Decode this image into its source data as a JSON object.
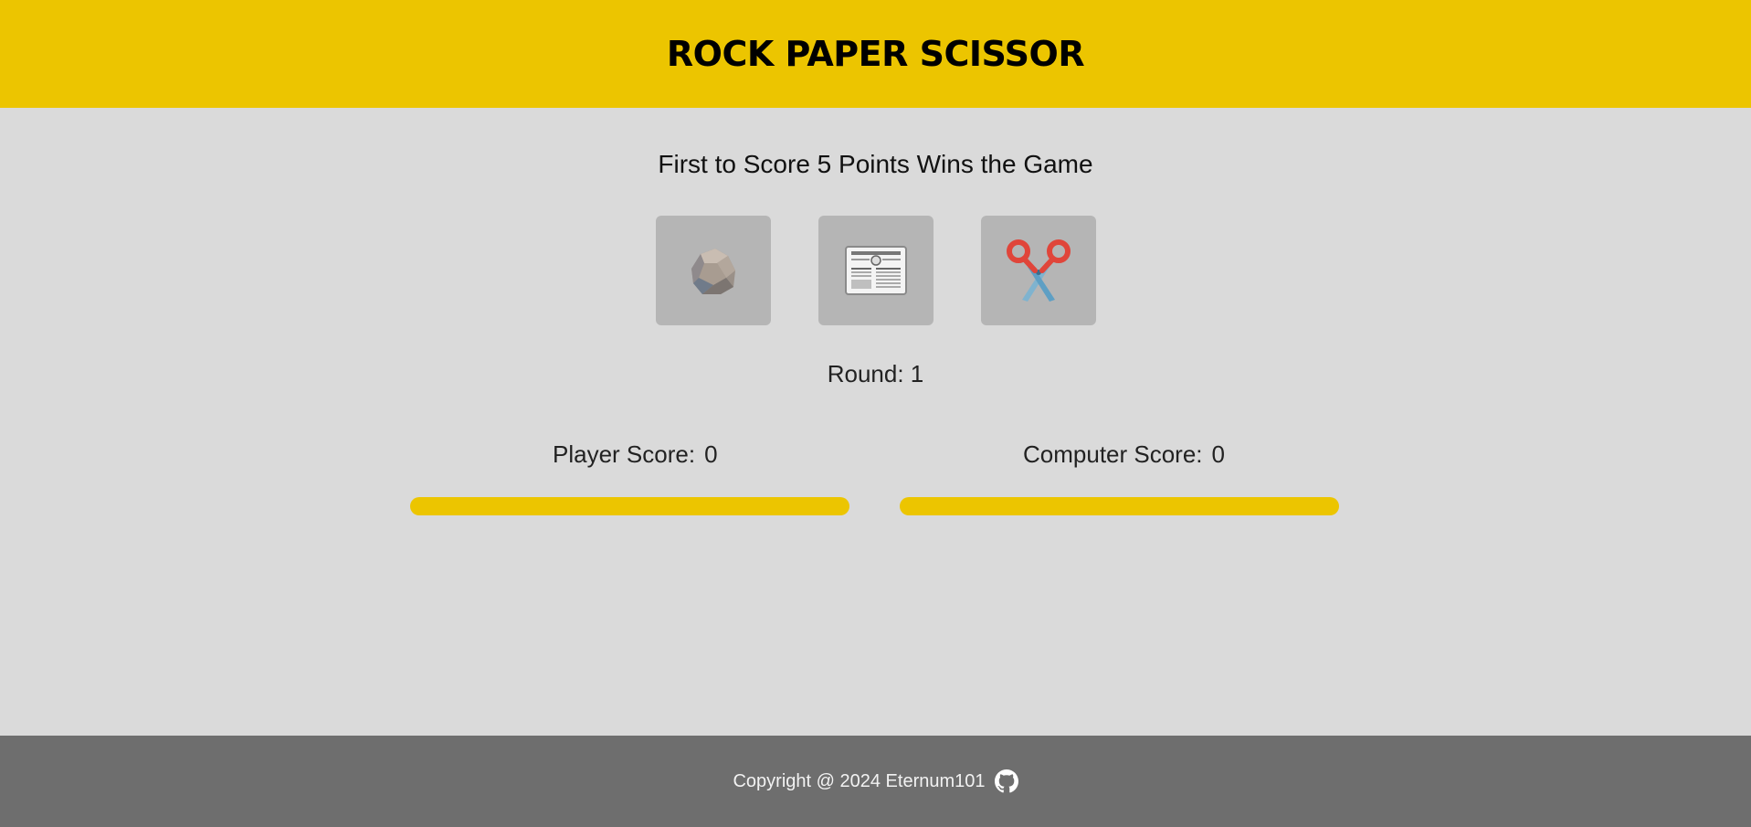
{
  "header": {
    "title": "ROCK PAPER SCISSOR"
  },
  "game": {
    "subtitle": "First to Score 5 Points Wins the Game",
    "choices": [
      {
        "name": "rock",
        "icon": "rock-icon"
      },
      {
        "name": "paper",
        "icon": "newspaper-icon"
      },
      {
        "name": "scissor",
        "icon": "scissors-icon"
      }
    ],
    "round_label": "Round: 1",
    "player_score_label": "Player Score:",
    "player_score": "0",
    "computer_score_label": "Computer Score:",
    "computer_score": "0",
    "player_progress": 0,
    "computer_progress": 0
  },
  "footer": {
    "copyright": "Copyright @ 2024 Eternum101",
    "link_icon": "github-icon"
  },
  "colors": {
    "accent": "#ecc500",
    "background": "#dadada",
    "choice_tile": "#b5b5b5",
    "footer": "#6e6e6e"
  }
}
